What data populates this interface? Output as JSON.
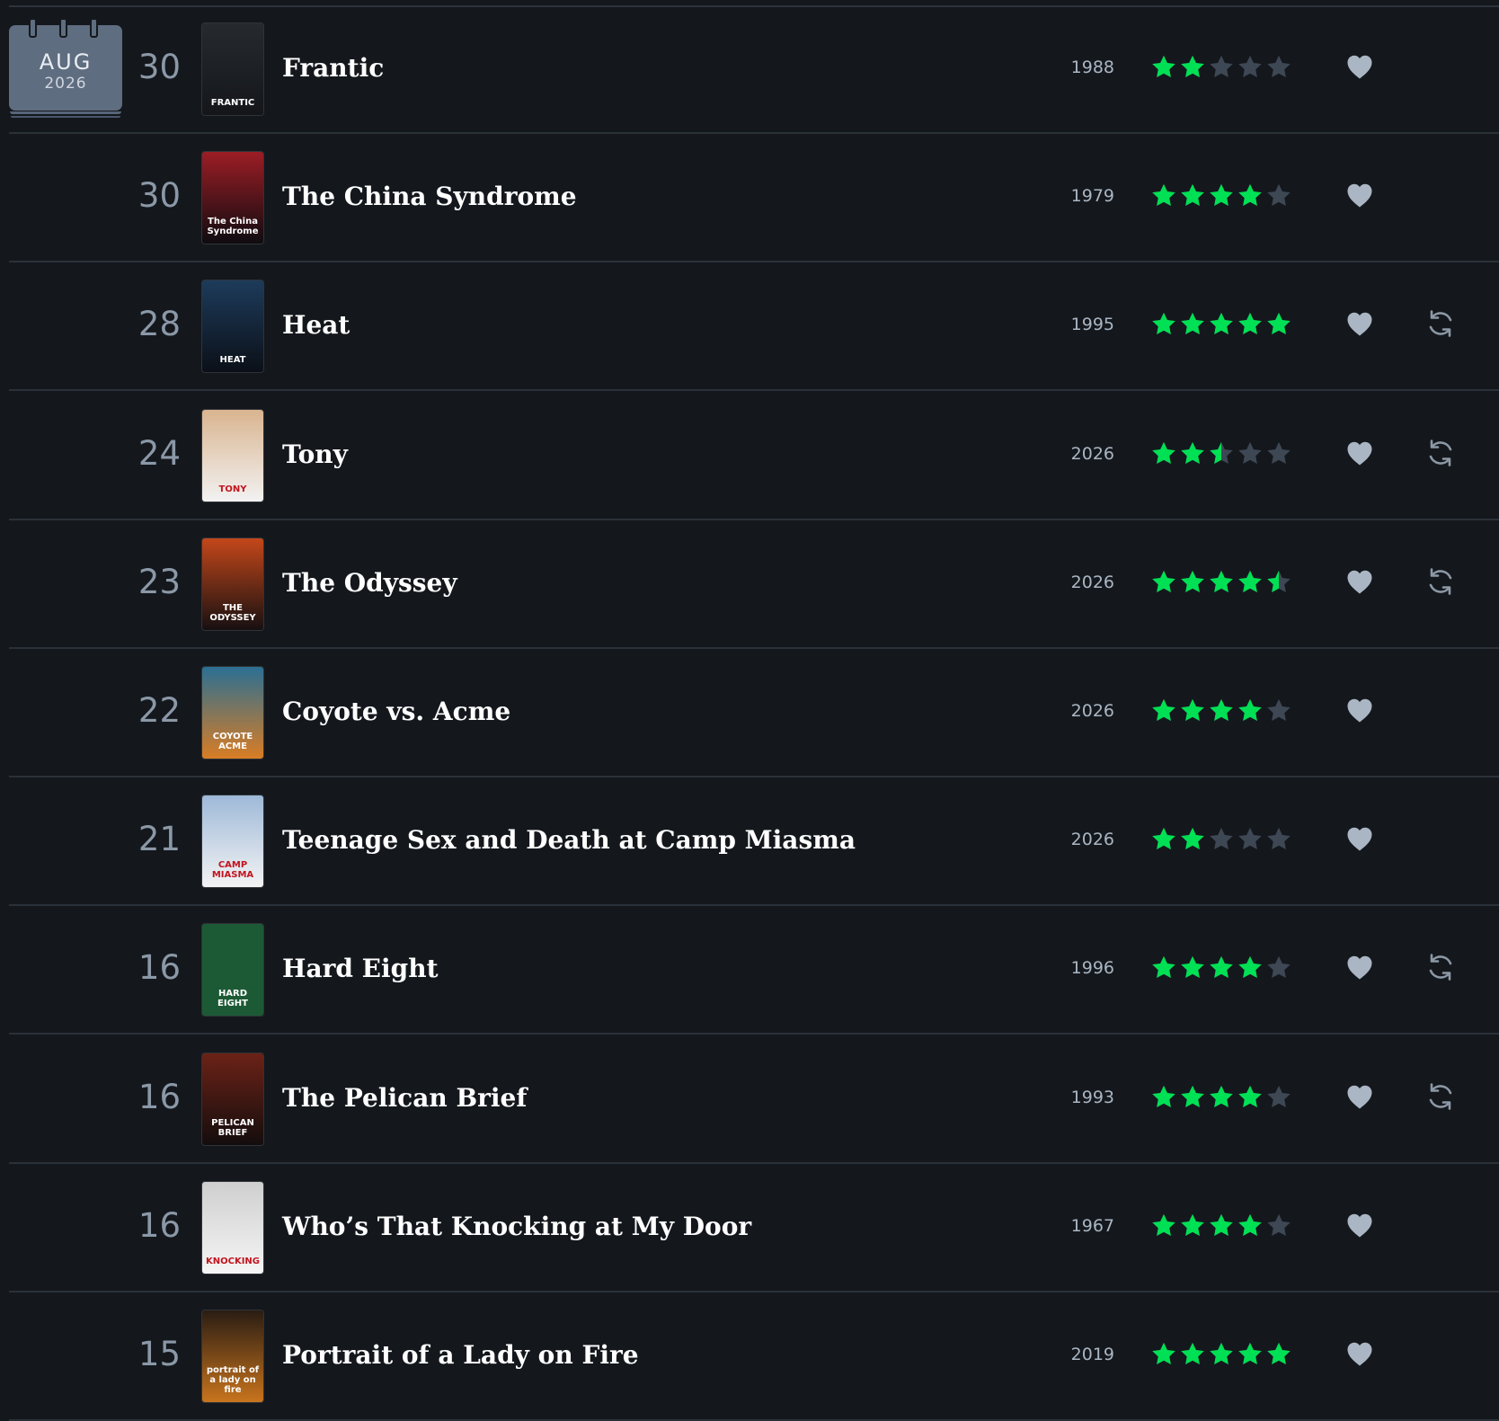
{
  "calendar": {
    "month": "AUG",
    "year": "2026"
  },
  "colors": {
    "star_on": "#00e054",
    "star_off": "#3e4754",
    "heart": "#aab6c3",
    "rewatch": "#8c98a5"
  },
  "entries": [
    {
      "day": "30",
      "title": "Frantic",
      "year": "1988",
      "rating": 2,
      "liked": true,
      "rewatch": false,
      "poster_caption": "FRANTIC",
      "poster_bg": [
        "#262a2f",
        "#14161a"
      ]
    },
    {
      "day": "30",
      "title": "The China Syndrome",
      "year": "1979",
      "rating": 4,
      "liked": true,
      "rewatch": false,
      "poster_caption": "The China Syndrome",
      "poster_bg": [
        "#9c1d25",
        "#0f0c10"
      ]
    },
    {
      "day": "28",
      "title": "Heat",
      "year": "1995",
      "rating": 5,
      "liked": true,
      "rewatch": true,
      "poster_caption": "HEAT",
      "poster_bg": [
        "#1d3b5a",
        "#0b1018"
      ]
    },
    {
      "day": "24",
      "title": "Tony",
      "year": "2026",
      "rating": 2.5,
      "liked": true,
      "rewatch": true,
      "poster_caption": "TONY",
      "poster_bg": [
        "#d9b48f",
        "#f2f2f2"
      ]
    },
    {
      "day": "23",
      "title": "The Odyssey",
      "year": "2026",
      "rating": 4.5,
      "liked": true,
      "rewatch": true,
      "poster_caption": "THE ODYSSEY",
      "poster_bg": [
        "#c4471a",
        "#171011"
      ]
    },
    {
      "day": "22",
      "title": "Coyote vs. Acme",
      "year": "2026",
      "rating": 4,
      "liked": true,
      "rewatch": false,
      "poster_caption": "COYOTE ACME",
      "poster_bg": [
        "#2b6f93",
        "#d97d24"
      ]
    },
    {
      "day": "21",
      "title": "Teenage Sex and Death at Camp Miasma",
      "year": "2026",
      "rating": 2,
      "liked": true,
      "rewatch": false,
      "poster_caption": "CAMP MIASMA",
      "poster_bg": [
        "#9eb9d8",
        "#f3f3f3"
      ]
    },
    {
      "day": "16",
      "title": "Hard Eight",
      "year": "1996",
      "rating": 4,
      "liked": true,
      "rewatch": true,
      "poster_caption": "HARD EIGHT",
      "poster_bg": [
        "#1c5a35",
        "#1c5a35"
      ]
    },
    {
      "day": "16",
      "title": "The Pelican Brief",
      "year": "1993",
      "rating": 4,
      "liked": true,
      "rewatch": true,
      "poster_caption": "PELICAN BRIEF",
      "poster_bg": [
        "#6b2217",
        "#140d0d"
      ]
    },
    {
      "day": "16",
      "title": "Who’s That Knocking at My Door",
      "year": "1967",
      "rating": 4,
      "liked": true,
      "rewatch": false,
      "poster_caption": "KNOCKING",
      "poster_bg": [
        "#cfcfcf",
        "#f5f5f5"
      ]
    },
    {
      "day": "15",
      "title": "Portrait of a Lady on Fire",
      "year": "2019",
      "rating": 5,
      "liked": true,
      "rewatch": false,
      "poster_caption": "portrait of a lady on fire",
      "poster_bg": [
        "#2a1d13",
        "#c8741d"
      ]
    }
  ]
}
